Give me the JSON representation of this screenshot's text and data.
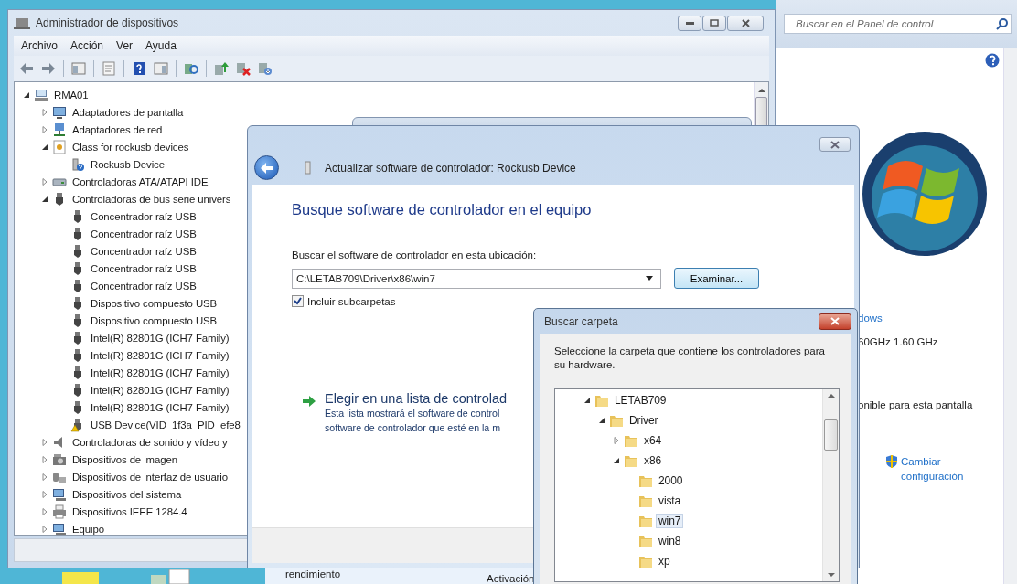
{
  "device_manager": {
    "title": "Administrador de dispositivos",
    "menu": [
      "Archivo",
      "Acción",
      "Ver",
      "Ayuda"
    ],
    "tree": {
      "label": "RMA01",
      "kind": "computer",
      "expanded": true,
      "children": [
        {
          "label": "Adaptadores de pantalla",
          "kind": "display",
          "expanded": false
        },
        {
          "label": "Adaptadores de red",
          "kind": "network",
          "expanded": false
        },
        {
          "label": "Class for rockusb devices",
          "kind": "class",
          "expanded": true,
          "children": [
            {
              "label": "Rockusb Device",
              "kind": "unknown"
            }
          ]
        },
        {
          "label": "Controladoras ATA/ATAPI IDE",
          "kind": "ide",
          "expanded": false
        },
        {
          "label": "Controladoras de bus serie univers",
          "kind": "usb",
          "expanded": true,
          "children": [
            {
              "label": "Concentrador raíz USB",
              "kind": "usb"
            },
            {
              "label": "Concentrador raíz USB",
              "kind": "usb"
            },
            {
              "label": "Concentrador raíz USB",
              "kind": "usb"
            },
            {
              "label": "Concentrador raíz USB",
              "kind": "usb"
            },
            {
              "label": "Concentrador raíz USB",
              "kind": "usb"
            },
            {
              "label": "Dispositivo compuesto USB",
              "kind": "usb"
            },
            {
              "label": "Dispositivo compuesto USB",
              "kind": "usb"
            },
            {
              "label": "Intel(R) 82801G (ICH7 Family)",
              "kind": "usb"
            },
            {
              "label": "Intel(R) 82801G (ICH7 Family)",
              "kind": "usb"
            },
            {
              "label": "Intel(R) 82801G (ICH7 Family)",
              "kind": "usb"
            },
            {
              "label": "Intel(R) 82801G (ICH7 Family)",
              "kind": "usb"
            },
            {
              "label": "Intel(R) 82801G (ICH7 Family)",
              "kind": "usb"
            },
            {
              "label": "USB Device(VID_1f3a_PID_efe8",
              "kind": "warning"
            }
          ]
        },
        {
          "label": "Controladoras de sonido y vídeo y",
          "kind": "sound",
          "expanded": false
        },
        {
          "label": "Dispositivos de imagen",
          "kind": "imaging",
          "expanded": false
        },
        {
          "label": "Dispositivos de interfaz de usuario",
          "kind": "hid",
          "expanded": false
        },
        {
          "label": "Dispositivos del sistema",
          "kind": "system",
          "expanded": false
        },
        {
          "label": "Dispositivos IEEE 1284.4",
          "kind": "printer",
          "expanded": false
        },
        {
          "label": "Equipo",
          "kind": "system",
          "expanded": false
        }
      ]
    }
  },
  "update_dialog": {
    "title": "Actualizar software de controlador: Rockusb Device",
    "heading": "Busque software de controlador en el equipo",
    "location_label": "Buscar el software de controlador en esta ubicación:",
    "path_value": "C:\\LETAB709\\Driver\\x86\\win7",
    "browse_button": "Examinar...",
    "include_subfolders": {
      "label": "Incluir subcarpetas",
      "checked": true
    },
    "option": {
      "title": "Elegir en una lista de controlad",
      "description_lines": [
        "Esta lista mostrará el software de control",
        "software de controlador que esté en la m"
      ]
    }
  },
  "folder_dialog": {
    "title": "Buscar carpeta",
    "instructions": "Seleccione la carpeta que contiene los controladores para su hardware.",
    "tree": [
      {
        "label": "LETAB709",
        "selected": false,
        "expanded": true,
        "children": [
          {
            "label": "Driver",
            "selected": false,
            "expanded": true,
            "children": [
              {
                "label": "x64",
                "selected": false,
                "expanded": false
              },
              {
                "label": "x86",
                "selected": false,
                "expanded": true,
                "children": [
                  {
                    "label": "2000",
                    "selected": false
                  },
                  {
                    "label": "vista",
                    "selected": false
                  },
                  {
                    "label": "win7",
                    "selected": true
                  },
                  {
                    "label": "win8",
                    "selected": false
                  },
                  {
                    "label": "xp",
                    "selected": false
                  }
                ]
              }
            ]
          }
        ]
      }
    ]
  },
  "control_panel": {
    "search_placeholder": "Buscar en el Panel de control",
    "texts": [
      "dows",
      "60GHz  1.60 GHz",
      "onible para esta pantalla"
    ],
    "link": "Cambiar configuración"
  },
  "background_texts": [
    "rendimiento",
    "Activación"
  ]
}
